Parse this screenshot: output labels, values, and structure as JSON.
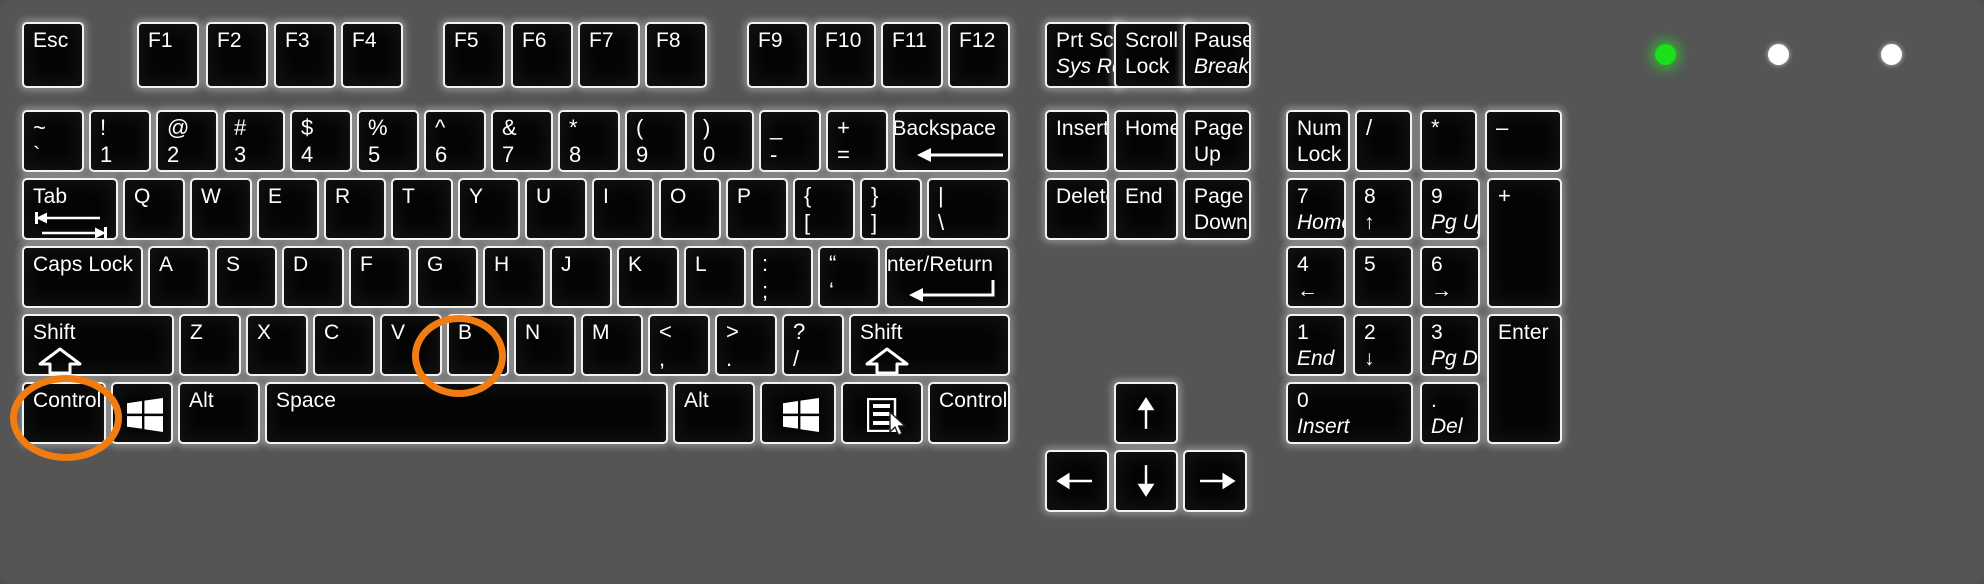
{
  "keyboard": {
    "title": "Full-size 104-key Windows keyboard layout diagram",
    "background_color": "#555555",
    "key_color": "#040404",
    "key_border_color": "#f2f2f2",
    "annotation_color": "#f07c12",
    "led_on_color": "#19e019",
    "led_off_color": "#ffffff"
  },
  "leds": [
    {
      "name": "led-1",
      "state": "on",
      "color": "#19e019"
    },
    {
      "name": "led-2",
      "state": "off",
      "color": "#ffffff"
    },
    {
      "name": "led-3",
      "state": "off",
      "color": "#ffffff"
    }
  ],
  "annotations": [
    {
      "name": "highlight-b-key",
      "target": "B",
      "shape": "circle",
      "color": "#f07c12"
    },
    {
      "name": "highlight-control-key",
      "target": "Control",
      "shape": "circle",
      "color": "#f07c12"
    }
  ],
  "rows": {
    "function_row": [
      {
        "name": "esc",
        "top": "Esc"
      },
      {
        "name": "f1",
        "top": "F1"
      },
      {
        "name": "f2",
        "top": "F2"
      },
      {
        "name": "f3",
        "top": "F3"
      },
      {
        "name": "f4",
        "top": "F4"
      },
      {
        "name": "f5",
        "top": "F5"
      },
      {
        "name": "f6",
        "top": "F6"
      },
      {
        "name": "f7",
        "top": "F7"
      },
      {
        "name": "f8",
        "top": "F8"
      },
      {
        "name": "f9",
        "top": "F9"
      },
      {
        "name": "f10",
        "top": "F10"
      },
      {
        "name": "f11",
        "top": "F11"
      },
      {
        "name": "f12",
        "top": "F12"
      },
      {
        "name": "print-screen",
        "top": "Prt Scrn",
        "bottom": "Sys Rq"
      },
      {
        "name": "scroll-lock",
        "top": "Scroll",
        "bottom": "Lock"
      },
      {
        "name": "pause-break",
        "top": "Pause",
        "bottom": "Break"
      }
    ],
    "number_row": [
      {
        "name": "backquote",
        "top": "~",
        "bottom": "`"
      },
      {
        "name": "digit-1",
        "top": "!",
        "bottom": "1"
      },
      {
        "name": "digit-2",
        "top": "@",
        "bottom": "2"
      },
      {
        "name": "digit-3",
        "top": "#",
        "bottom": "3"
      },
      {
        "name": "digit-4",
        "top": "$",
        "bottom": "4"
      },
      {
        "name": "digit-5",
        "top": "%",
        "bottom": "5"
      },
      {
        "name": "digit-6",
        "top": "^",
        "bottom": "6"
      },
      {
        "name": "digit-7",
        "top": "&",
        "bottom": "7"
      },
      {
        "name": "digit-8",
        "top": "*",
        "bottom": "8"
      },
      {
        "name": "digit-9",
        "top": "(",
        "bottom": "9"
      },
      {
        "name": "digit-0",
        "top": ")",
        "bottom": "0"
      },
      {
        "name": "minus",
        "top": "_",
        "bottom": "-"
      },
      {
        "name": "equal",
        "top": "+",
        "bottom": "="
      },
      {
        "name": "backspace",
        "top": "Backspace",
        "glyph": "arrow-left"
      }
    ],
    "tab_row": [
      {
        "name": "tab",
        "top": "Tab",
        "glyph": "tab-arrows"
      },
      {
        "name": "key-q",
        "top": "Q"
      },
      {
        "name": "key-w",
        "top": "W"
      },
      {
        "name": "key-e",
        "top": "E"
      },
      {
        "name": "key-r",
        "top": "R"
      },
      {
        "name": "key-t",
        "top": "T"
      },
      {
        "name": "key-y",
        "top": "Y"
      },
      {
        "name": "key-u",
        "top": "U"
      },
      {
        "name": "key-i",
        "top": "I"
      },
      {
        "name": "key-o",
        "top": "O"
      },
      {
        "name": "key-p",
        "top": "P"
      },
      {
        "name": "bracket-left",
        "top": "{",
        "bottom": "["
      },
      {
        "name": "bracket-right",
        "top": "}",
        "bottom": "]"
      },
      {
        "name": "backslash",
        "top": "|",
        "bottom": "\\"
      }
    ],
    "home_row": [
      {
        "name": "caps-lock",
        "top": "Caps Lock"
      },
      {
        "name": "key-a",
        "top": "A"
      },
      {
        "name": "key-s",
        "top": "S"
      },
      {
        "name": "key-d",
        "top": "D"
      },
      {
        "name": "key-f",
        "top": "F"
      },
      {
        "name": "key-g",
        "top": "G"
      },
      {
        "name": "key-h",
        "top": "H"
      },
      {
        "name": "key-j",
        "top": "J"
      },
      {
        "name": "key-k",
        "top": "K"
      },
      {
        "name": "key-l",
        "top": "L"
      },
      {
        "name": "semicolon",
        "top": ":",
        "bottom": ";"
      },
      {
        "name": "quote",
        "top": "“",
        "bottom": "‘"
      },
      {
        "name": "enter-return",
        "top": "Enter/Return",
        "glyph": "return-arrow"
      }
    ],
    "shift_row": [
      {
        "name": "shift-left",
        "top": "Shift",
        "glyph": "shift-up"
      },
      {
        "name": "key-z",
        "top": "Z"
      },
      {
        "name": "key-x",
        "top": "X"
      },
      {
        "name": "key-c",
        "top": "C"
      },
      {
        "name": "key-v",
        "top": "V"
      },
      {
        "name": "key-b",
        "top": "B"
      },
      {
        "name": "key-n",
        "top": "N"
      },
      {
        "name": "key-m",
        "top": "M"
      },
      {
        "name": "comma",
        "top": "<",
        "bottom": ","
      },
      {
        "name": "period",
        "top": ">",
        "bottom": "."
      },
      {
        "name": "slash",
        "top": "?",
        "bottom": "/"
      },
      {
        "name": "shift-right",
        "top": "Shift",
        "glyph": "shift-up"
      }
    ],
    "bottom_row": [
      {
        "name": "control-left",
        "top": "Control"
      },
      {
        "name": "win-left",
        "glyph": "windows-logo"
      },
      {
        "name": "alt-left",
        "top": "Alt"
      },
      {
        "name": "space",
        "top": "Space"
      },
      {
        "name": "alt-right",
        "top": "Alt"
      },
      {
        "name": "win-right",
        "glyph": "windows-logo"
      },
      {
        "name": "menu",
        "glyph": "menu-icon"
      },
      {
        "name": "control-right",
        "top": "Control"
      }
    ]
  },
  "nav_cluster": [
    {
      "name": "insert",
      "top": "Insert"
    },
    {
      "name": "home",
      "top": "Home"
    },
    {
      "name": "page-up",
      "top": "Page",
      "bottom": "Up"
    },
    {
      "name": "delete",
      "top": "Delete"
    },
    {
      "name": "end",
      "top": "End"
    },
    {
      "name": "page-down",
      "top": "Page",
      "bottom": "Down"
    }
  ],
  "arrow_cluster": [
    {
      "name": "arrow-up",
      "glyph": "↑"
    },
    {
      "name": "arrow-left",
      "glyph": "←"
    },
    {
      "name": "arrow-down",
      "glyph": "↓"
    },
    {
      "name": "arrow-right",
      "glyph": "→"
    }
  ],
  "numpad": [
    {
      "name": "num-lock",
      "top": "Num",
      "bottom": "Lock"
    },
    {
      "name": "numpad-divide",
      "top": "/"
    },
    {
      "name": "numpad-multiply",
      "top": "*"
    },
    {
      "name": "numpad-subtract",
      "top": "–"
    },
    {
      "name": "numpad-7",
      "top": "7",
      "bottom": "Home"
    },
    {
      "name": "numpad-8",
      "top": "8",
      "bottom": "↑"
    },
    {
      "name": "numpad-9",
      "top": "9",
      "bottom": "Pg Up"
    },
    {
      "name": "numpad-add",
      "top": "+"
    },
    {
      "name": "numpad-4",
      "top": "4",
      "bottom": "←"
    },
    {
      "name": "numpad-5",
      "top": "5"
    },
    {
      "name": "numpad-6",
      "top": "6",
      "bottom": "→"
    },
    {
      "name": "numpad-1",
      "top": "1",
      "bottom": "End"
    },
    {
      "name": "numpad-2",
      "top": "2",
      "bottom": "↓"
    },
    {
      "name": "numpad-3",
      "top": "3",
      "bottom": "Pg Dn"
    },
    {
      "name": "numpad-enter",
      "top": "Enter"
    },
    {
      "name": "numpad-0",
      "top": "0",
      "bottom": "Insert"
    },
    {
      "name": "numpad-decimal",
      "top": ".",
      "bottom": "Del"
    }
  ]
}
